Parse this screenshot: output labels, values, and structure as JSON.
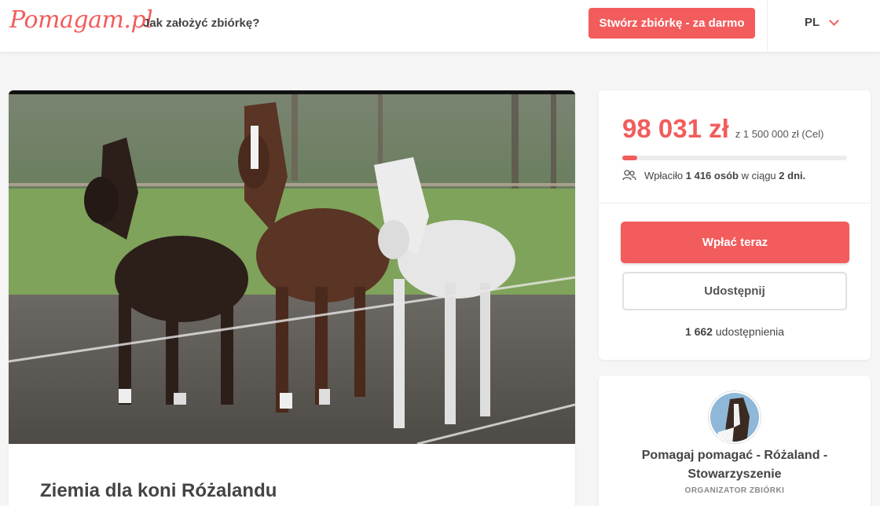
{
  "header": {
    "logo": "Pomagam.pl",
    "how_link": "Jak założyć zbiórkę?",
    "create_button": "Stwórz zbiórkę - za darmo",
    "language": "PL"
  },
  "campaign": {
    "title": "Ziemia dla koni Różalandu",
    "image": "horses-photo"
  },
  "donation": {
    "raised": "98 031 zł",
    "goal_text": "z 1 500 000 zł (Cel)",
    "progress_percent": 6.5,
    "stats_prefix": "Wpłaciło",
    "donors": "1 416 osób",
    "stats_middle": "w ciągu",
    "days": "2 dni.",
    "pay_button": "Wpłać teraz",
    "share_button": "Udostępnij",
    "shares_count": "1 662",
    "shares_label": "udostępnienia"
  },
  "organizer": {
    "name": "Pomagaj pomagać - Różaland - Stowarzyszenie",
    "role": "ORGANIZATOR ZBIÓRKI"
  },
  "colors": {
    "accent": "#f25c5c",
    "background": "#f5f5f5"
  },
  "icons": {
    "users": "users-icon",
    "chevron": "chevron-down-icon"
  }
}
